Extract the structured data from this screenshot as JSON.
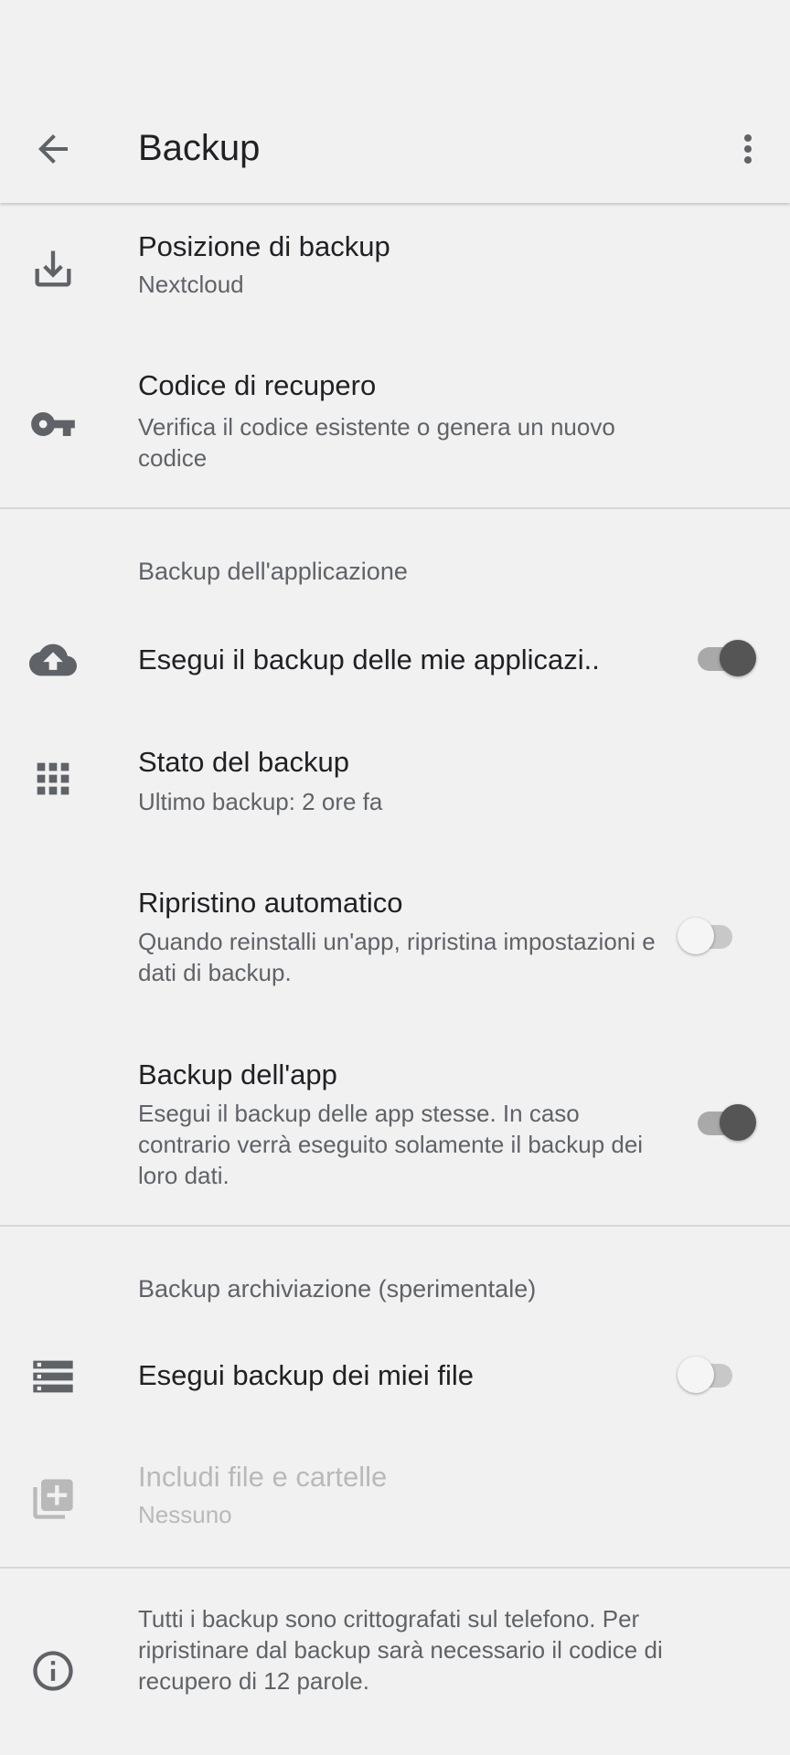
{
  "app_bar": {
    "title": "Backup",
    "back_icon": "arrow-back-icon",
    "more_icon": "more-vert-icon"
  },
  "items": {
    "location": {
      "icon": "download-icon",
      "title": "Posizione di backup",
      "subtitle": "Nextcloud"
    },
    "recovery_code": {
      "icon": "key-icon",
      "title": "Codice di recupero",
      "subtitle": "Verifica il codice esistente o genera un nuovo codice"
    },
    "app_section_header": "Backup dell'applicazione",
    "backup_apps": {
      "icon": "cloud-upload-icon",
      "title": "Esegui il backup delle mie applicazi..",
      "enabled": true
    },
    "backup_status": {
      "icon": "apps-grid-icon",
      "title": "Stato del backup",
      "subtitle": "Ultimo backup: 2 ore fa"
    },
    "auto_restore": {
      "title": "Ripristino automatico",
      "subtitle": "Quando reinstalli un'app, ripristina impostazioni e dati di backup.",
      "enabled": false
    },
    "app_backup": {
      "title": "Backup dell'app",
      "subtitle": "Esegui il backup delle app stesse. In caso contrario verrà eseguito solamente il backup dei loro dati.",
      "enabled": true
    },
    "storage_section_header": "Backup archiviazione (sperimentale)",
    "backup_files": {
      "icon": "storage-list-icon",
      "title": "Esegui backup dei miei file",
      "enabled": false
    },
    "include_files": {
      "icon": "library-add-icon",
      "title": "Includi file e cartelle",
      "subtitle": "Nessuno",
      "disabled": true
    },
    "info": {
      "icon": "info-icon",
      "text": "Tutti i backup sono crittografati sul telefono. Per ripristinare dal backup sarà necessario il codice di recupero di 12 parole."
    }
  },
  "colors": {
    "background": "#f1f1f1",
    "switch_on_thumb": "#555555",
    "switch_off_thumb": "#f5f5f5"
  }
}
